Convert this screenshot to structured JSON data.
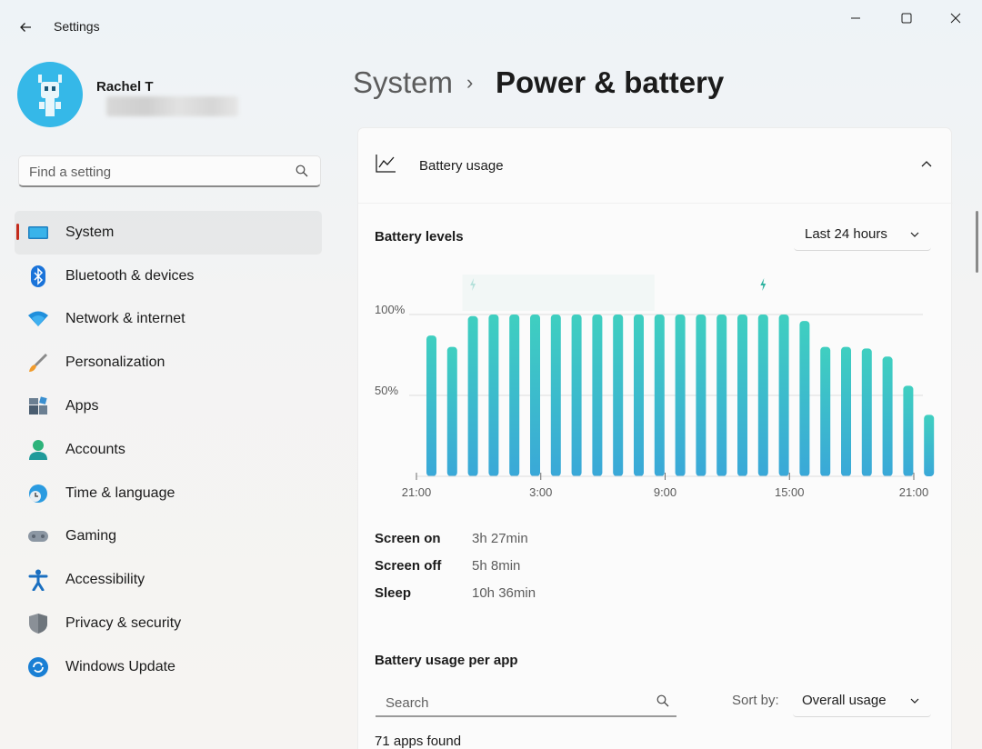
{
  "window": {
    "app_title": "Settings",
    "controls": [
      "minimize-icon",
      "maximize-icon",
      "close-icon"
    ]
  },
  "user": {
    "name": "Rachel T"
  },
  "search": {
    "placeholder": "Find a setting"
  },
  "sidebar": {
    "items": [
      {
        "label": "System",
        "icon": "system-icon",
        "active": true
      },
      {
        "label": "Bluetooth & devices",
        "icon": "bluetooth-icon"
      },
      {
        "label": "Network & internet",
        "icon": "wifi-icon"
      },
      {
        "label": "Personalization",
        "icon": "brush-icon"
      },
      {
        "label": "Apps",
        "icon": "apps-icon"
      },
      {
        "label": "Accounts",
        "icon": "accounts-icon"
      },
      {
        "label": "Time & language",
        "icon": "globe-clock-icon"
      },
      {
        "label": "Gaming",
        "icon": "gamepad-icon"
      },
      {
        "label": "Accessibility",
        "icon": "accessibility-icon"
      },
      {
        "label": "Privacy & security",
        "icon": "shield-icon"
      },
      {
        "label": "Windows Update",
        "icon": "update-icon"
      }
    ]
  },
  "header": {
    "breadcrumb_parent": "System",
    "breadcrumb_separator": "›",
    "page_title": "Power & battery"
  },
  "battery_usage": {
    "section_label": "Battery usage",
    "levels_title": "Battery levels",
    "range_selected": "Last 24 hours",
    "stats": [
      {
        "label": "Screen on",
        "value": "3h 27min"
      },
      {
        "label": "Screen off",
        "value": "5h 8min"
      },
      {
        "label": "Sleep",
        "value": "10h 36min"
      }
    ],
    "per_app_title": "Battery usage per app",
    "app_search_placeholder": "Search",
    "sort_by_label": "Sort by:",
    "sort_selected": "Overall usage",
    "apps_found": "71 apps found"
  },
  "colors": {
    "bar_top": "#3fcfc0",
    "bar_bottom": "#3aa8d8",
    "accent_indicator": "#c42b1c"
  },
  "chart_data": {
    "type": "bar",
    "title": "",
    "ylabel": "",
    "xlabel": "",
    "y_ticks": [
      "50%",
      "100%"
    ],
    "x_tick_labels": [
      "21:00",
      "3:00",
      "9:00",
      "15:00",
      "21:00"
    ],
    "ylim": [
      0,
      100
    ],
    "values": [
      87,
      80,
      99,
      100,
      100,
      100,
      100,
      100,
      100,
      100,
      100,
      100,
      100,
      100,
      100,
      100,
      100,
      100,
      96,
      80,
      80,
      79,
      74,
      56,
      38
    ],
    "charging_markers_at_bar_index": [
      2,
      16
    ],
    "grid": true
  }
}
